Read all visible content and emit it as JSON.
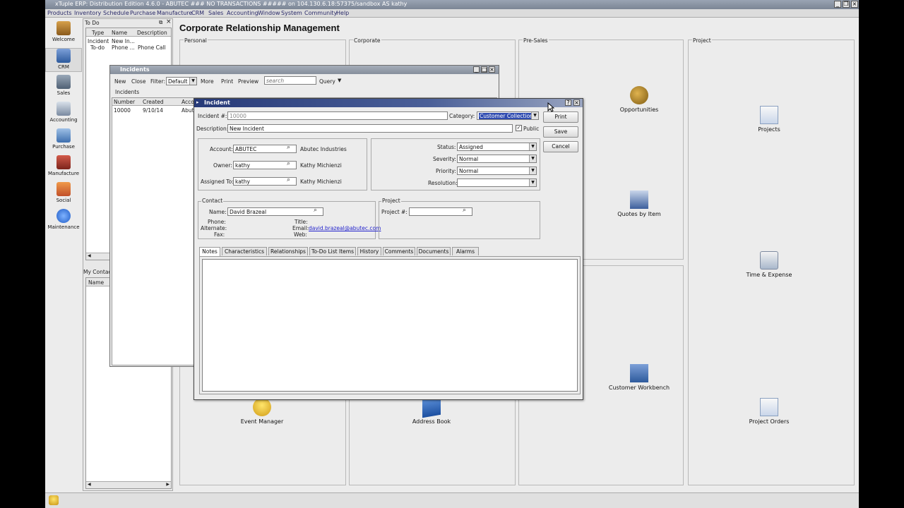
{
  "app": {
    "title": "xTuple ERP: Distribution Edition 4.6.0 - ABUTEC ### NO TRANSACTIONS ##### on 104.130.6.18:57375/sandbox AS kathy",
    "menu": [
      "Products",
      "Inventory",
      "Schedule",
      "Purchase",
      "Manufacture",
      "CRM",
      "Sales",
      "Accounting",
      "Window",
      "System",
      "Community",
      "Help"
    ]
  },
  "launcher": [
    "Welcome",
    "CRM",
    "Sales",
    "Accounting",
    "Purchase",
    "Manufacture",
    "Social",
    "Maintenance"
  ],
  "todo": {
    "title": "To Do",
    "columns": [
      "Type",
      "Name",
      "Description"
    ],
    "rows": [
      {
        "type": "Incident",
        "name": "New In...",
        "desc": ""
      },
      {
        "type": "To-do",
        "name": "Phone ...",
        "desc": "Phone Call"
      }
    ],
    "contacts_title": "My Contacts",
    "contacts_col": "Name"
  },
  "crm": {
    "heading": "Corporate Relationship Management",
    "sections": [
      "Personal",
      "Corporate",
      "Pre-Sales",
      "Project"
    ],
    "tiles": {
      "opportunities": "Opportunities",
      "projects": "Projects",
      "quotes_by_item": "Quotes by Item",
      "time_expense": "Time & Expense",
      "customer_workbench": "Customer Workbench",
      "event_manager": "Event Manager",
      "address_book": "Address Book",
      "project_orders": "Project Orders"
    }
  },
  "incidents": {
    "title": "Incidents",
    "toolbar": {
      "new": "New",
      "close": "Close",
      "filter_label": "Filter:",
      "filter_value": "Default",
      "more": "More",
      "print": "Print",
      "preview": "Preview",
      "search_placeholder": "search",
      "query": "Query"
    },
    "list_label": "Incidents",
    "columns": [
      "Number",
      "Created",
      "Acco"
    ],
    "rows": [
      {
        "number": "10000",
        "created": "9/10/14",
        "account": "Abut"
      }
    ]
  },
  "incident": {
    "title": "Incident",
    "number_label": "Incident #:",
    "number": "10000",
    "category_label": "Category:",
    "category": "Customer Collections",
    "description_label": "Description:",
    "description": "New Incident",
    "public_label": "Public",
    "buttons": {
      "print": "Print",
      "save": "Save",
      "cancel": "Cancel"
    },
    "account_label": "Account:",
    "account": "ABUTEC",
    "account_name": "Abutec Industries",
    "owner_label": "Owner:",
    "owner": "kathy",
    "owner_name": "Kathy Michienzi",
    "assigned_label": "Assigned To:",
    "assigned": "kathy",
    "assigned_name": "Kathy Michienzi",
    "status_label": "Status:",
    "status": "Assigned",
    "severity_label": "Severity:",
    "severity": "Normal",
    "priority_label": "Priority:",
    "priority": "Normal",
    "resolution_label": "Resolution:",
    "resolution": "",
    "contact_group": "Contact",
    "contact_name_label": "Name:",
    "contact_name": "David Brazeal",
    "phone_label": "Phone:",
    "alternate_label": "Alternate:",
    "fax_label": "Fax:",
    "title_label": "Title:",
    "email_label": "Email:",
    "email": "david.brazeal@abutec.com",
    "web_label": "Web:",
    "project_group": "Project",
    "project_label": "Project #:",
    "tabs": [
      "Notes",
      "Characteristics",
      "Relationships",
      "To-Do List Items",
      "History",
      "Comments",
      "Documents",
      "Alarms"
    ]
  },
  "colors": {
    "titlebar_active": "#2b3f7a",
    "accent_selection": "#2f4bb0",
    "link": "#2222cc"
  }
}
